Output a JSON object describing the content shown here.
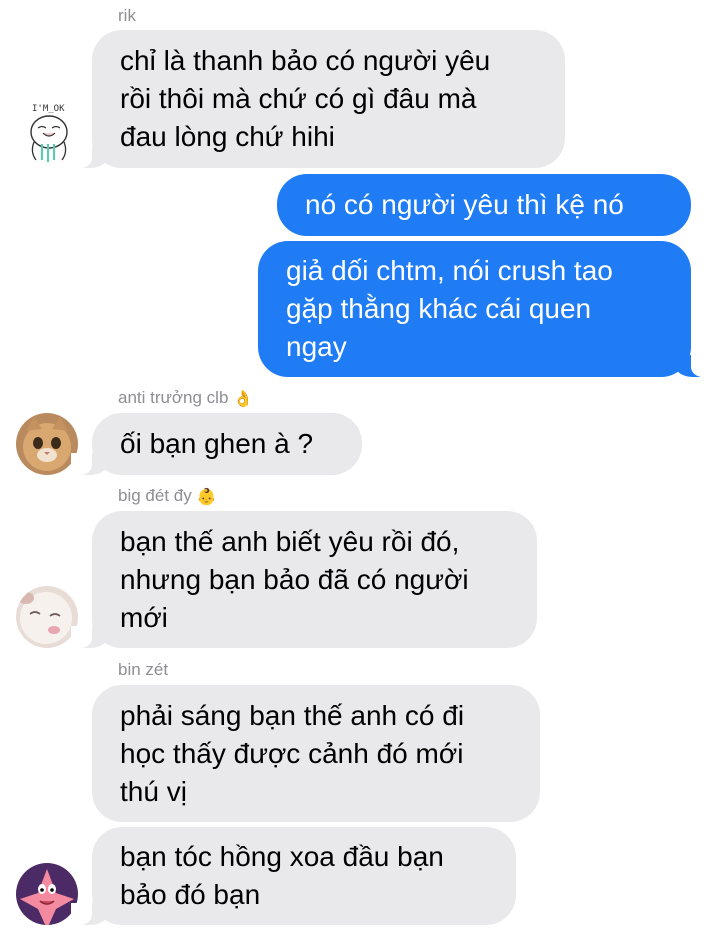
{
  "messages": [
    {
      "sender": "rik",
      "sender_emoji": "",
      "avatar": "im-ok-sticker-avatar",
      "avatar_text": "I'M_OK",
      "lines": [
        "chỉ là thanh bảo có người yêu",
        "rồi thôi mà chứ có gì đâu mà",
        "đau lòng chứ hihi"
      ],
      "direction": "incoming"
    },
    {
      "sender": "",
      "lines": [
        "nó có người yêu thì kệ nó"
      ],
      "direction": "outgoing"
    },
    {
      "sender": "",
      "lines": [
        "giả dối chtm, nói crush tao",
        "gặp thằng khác cái quen",
        "ngay"
      ],
      "direction": "outgoing"
    },
    {
      "sender": "anti trưởng clb",
      "sender_emoji": "👌",
      "avatar": "cat-avatar",
      "lines": [
        "ối bạn ghen à ?"
      ],
      "direction": "incoming"
    },
    {
      "sender": "big đét đy",
      "sender_emoji": "👶",
      "avatar": "sleeping-cat-avatar",
      "lines": [
        "bạn thế anh biết yêu rồi đó,",
        "nhưng bạn bảo đã có người",
        "mới"
      ],
      "direction": "incoming"
    },
    {
      "sender": "bin zét",
      "sender_emoji": "",
      "lines": [
        "phải sáng bạn thế anh có đi",
        "học thấy được cảnh đó mới",
        "thú vị"
      ],
      "direction": "incoming"
    },
    {
      "sender": "",
      "avatar": "patrick-star-avatar",
      "lines": [
        "bạn tóc hồng xoa đầu bạn",
        "bảo đó bạn"
      ],
      "direction": "incoming"
    }
  ],
  "colors": {
    "incoming_bubble": "#e9e9eb",
    "outgoing_bubble": "#1f7cf5",
    "sender_name": "#8e8e93"
  }
}
